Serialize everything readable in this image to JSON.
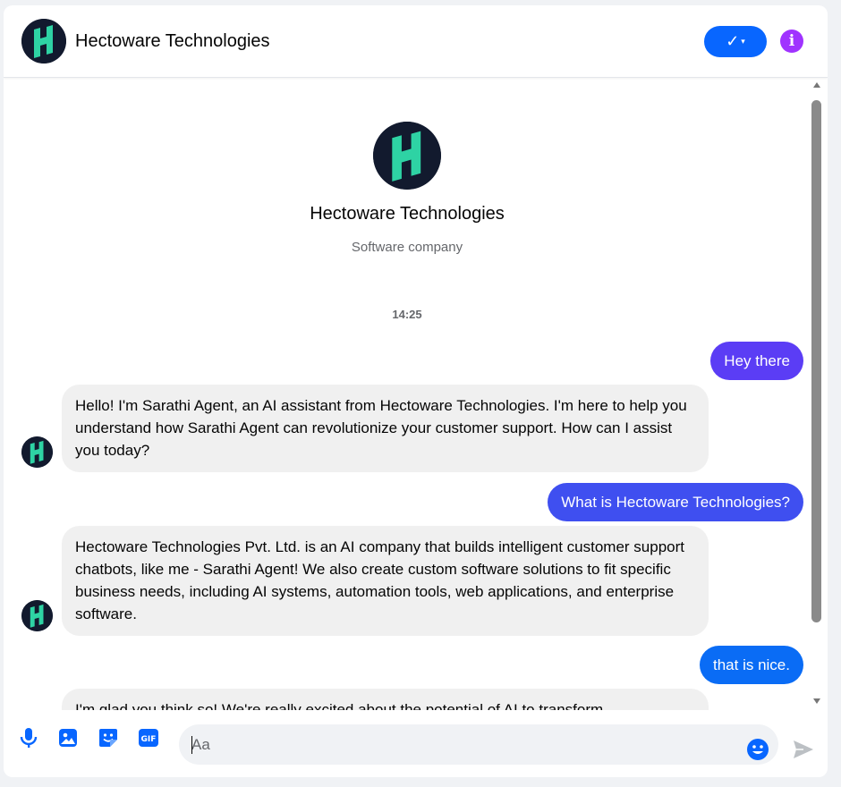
{
  "header": {
    "title": "Hectoware Technologies",
    "verify_label": "✓",
    "verify_caret": "▾",
    "info_label": "i"
  },
  "profile": {
    "name": "Hectoware Technologies",
    "subtitle": "Software company"
  },
  "timestamp": "14:25",
  "messages": [
    {
      "from": "user",
      "text": "Hey there"
    },
    {
      "from": "bot",
      "text": "Hello! I'm Sarathi Agent, an AI assistant from Hectoware Technologies. I'm here to help you understand how Sarathi Agent can revolutionize your customer support. How can I assist you today?"
    },
    {
      "from": "user",
      "text": "What is Hectoware Technologies?"
    },
    {
      "from": "bot",
      "text": "Hectoware Technologies Pvt. Ltd. is an AI company that builds intelligent customer support chatbots, like me - Sarathi Agent! We also create custom software solutions to fit specific business needs, including AI systems, automation tools, web applications, and enterprise software."
    },
    {
      "from": "user",
      "text": "that is nice."
    },
    {
      "from": "bot",
      "text": "I'm glad you think so! We're really excited about the potential of AI to transform"
    }
  ],
  "composer": {
    "placeholder": "Aa",
    "value": ""
  },
  "icons": {
    "brand_logo": "hectoware-h-logo",
    "mic": "microphone-icon",
    "image": "image-icon",
    "sticker": "sticker-icon",
    "gif": "gif-icon",
    "emoji": "emoji-icon",
    "send": "send-icon"
  },
  "colors": {
    "accent": "#0866ff",
    "info": "#a033ff",
    "bubble_out_1": "#5b3df5",
    "bubble_out_2": "#3f4ff0",
    "bubble_out_3": "#0a6cf5",
    "bubble_in": "#f0f0f0",
    "logo_green": "#2ed3a4",
    "logo_bg": "#121a2e"
  }
}
